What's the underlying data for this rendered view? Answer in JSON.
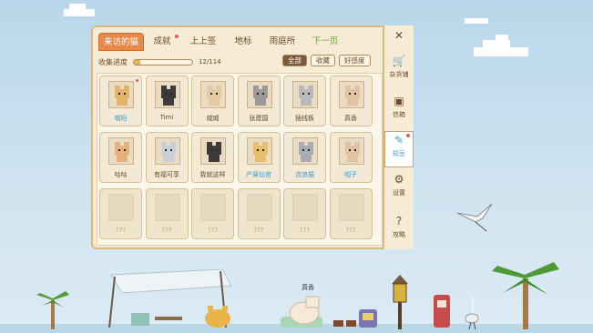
{
  "tabs": [
    {
      "label": "来访的猫",
      "active": true,
      "dot": false
    },
    {
      "label": "成就",
      "active": false,
      "dot": true
    },
    {
      "label": "上上签",
      "active": false,
      "dot": false
    },
    {
      "label": "地标",
      "active": false,
      "dot": false
    },
    {
      "label": "雨庭所",
      "active": false,
      "dot": false
    },
    {
      "label": "下一页",
      "active": false,
      "dot": false
    }
  ],
  "progress": {
    "label": "收集进度",
    "count": "12/114",
    "fraction": 0.105
  },
  "filters": [
    {
      "label": "全部",
      "active": true
    },
    {
      "label": "收藏",
      "active": false
    },
    {
      "label": "好感度",
      "active": false
    }
  ],
  "cats": [
    {
      "name": "咽阳",
      "blue": true,
      "dot": true,
      "color": "#e3b36e"
    },
    {
      "name": "Timi",
      "blue": false,
      "dot": false,
      "color": "#3d3a3a"
    },
    {
      "name": "威威",
      "blue": false,
      "dot": false,
      "color": "#e4c9a2"
    },
    {
      "name": "张建国",
      "blue": false,
      "dot": false,
      "color": "#9a9a9a"
    },
    {
      "name": "插线板",
      "blue": false,
      "dot": false,
      "color": "#b8b8bd"
    },
    {
      "name": "真香",
      "blue": false,
      "dot": false,
      "color": "#e2c3a0"
    },
    {
      "name": "咕咕",
      "blue": false,
      "dot": false,
      "color": "#e7b07a"
    },
    {
      "name": "有福可享",
      "blue": false,
      "dot": false,
      "color": "#c9cfd8"
    },
    {
      "name": "我就这样",
      "blue": false,
      "dot": false,
      "color": "#3d3a3a"
    },
    {
      "name": "产屎仙官",
      "blue": true,
      "dot": false,
      "color": "#e7bf6a"
    },
    {
      "name": "流浪猫",
      "blue": true,
      "dot": false,
      "color": "#a8acb5"
    },
    {
      "name": "咽子",
      "blue": true,
      "dot": false,
      "color": "#e2c3a0"
    }
  ],
  "locked_label": "???",
  "locked_count": 6,
  "sidebar": [
    {
      "label": "杂货铺",
      "icon": "cart-icon",
      "glyph": "🛒",
      "active": false,
      "dot": false
    },
    {
      "label": "信箱",
      "icon": "mailbox-icon",
      "glyph": "▣",
      "active": false,
      "dot": false
    },
    {
      "label": "知豆",
      "icon": "book-icon",
      "glyph": "✎",
      "active": true,
      "dot": true
    },
    {
      "label": "设置",
      "icon": "gear-icon",
      "glyph": "⚙",
      "active": false,
      "dot": false
    },
    {
      "label": "攻略",
      "icon": "help-icon",
      "glyph": "?",
      "active": false,
      "dot": false
    }
  ],
  "close_glyph": "✕",
  "scene_label": "真香"
}
